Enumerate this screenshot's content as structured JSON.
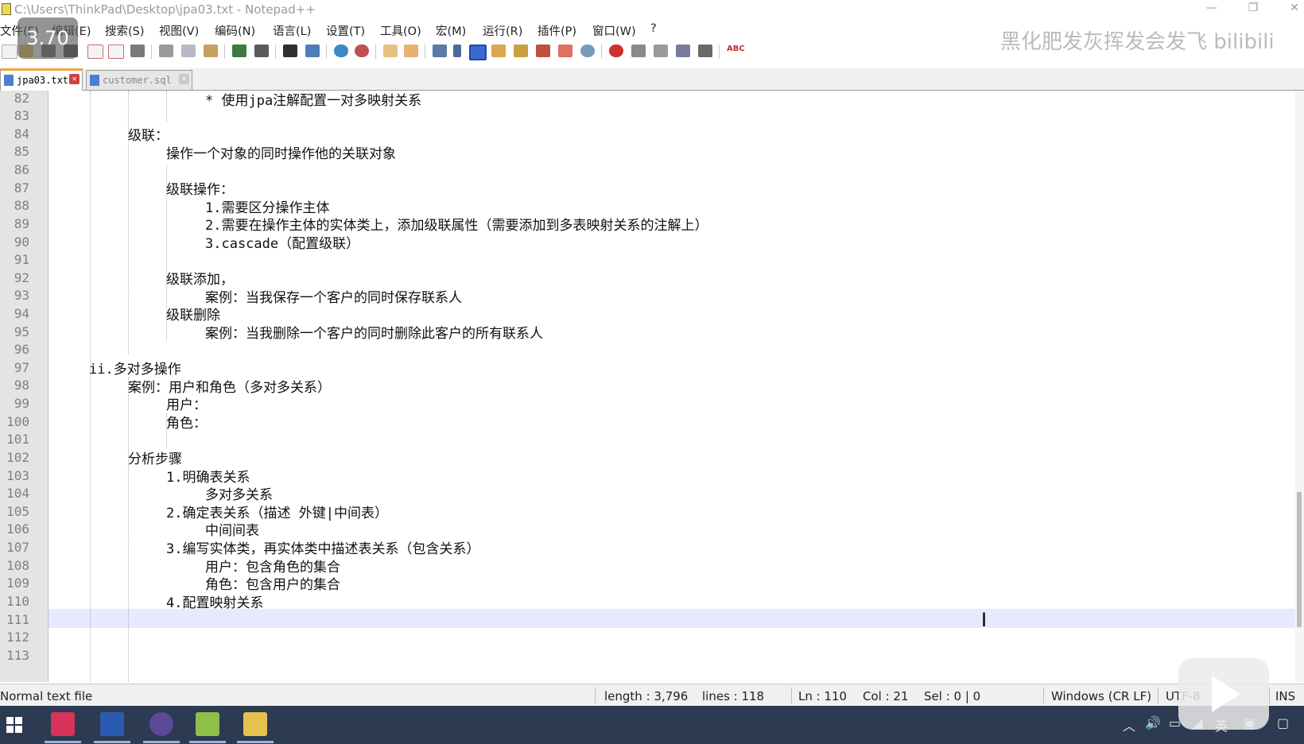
{
  "window": {
    "title": "C:\\Users\\ThinkPad\\Desktop\\jpa03.txt - Notepad++",
    "minimize_glyph": "—",
    "restore_glyph": "❐",
    "close_glyph": "✕"
  },
  "menu": [
    {
      "id": "file",
      "label": "文件(F)"
    },
    {
      "id": "edit",
      "label": "编辑(E)"
    },
    {
      "id": "search",
      "label": "搜索(S)"
    },
    {
      "id": "view",
      "label": "视图(V)"
    },
    {
      "id": "encoding",
      "label": "编码(N)"
    },
    {
      "id": "language",
      "label": "语言(L)"
    },
    {
      "id": "settings",
      "label": "设置(T)"
    },
    {
      "id": "tools",
      "label": "工具(O)"
    },
    {
      "id": "macro",
      "label": "宏(M)"
    },
    {
      "id": "run",
      "label": "运行(R)"
    },
    {
      "id": "plugins",
      "label": "插件(P)"
    },
    {
      "id": "window",
      "label": "窗口(W)"
    },
    {
      "id": "help",
      "label": "?"
    }
  ],
  "toolbar": {
    "icons": [
      "new-file-icon",
      "open-file-icon",
      "save-icon",
      "save-all-icon",
      "close-icon",
      "close-all-icon",
      "print-icon",
      "cut-icon",
      "copy-icon",
      "paste-icon",
      "undo-icon",
      "redo-icon",
      "find-icon",
      "replace-icon",
      "zoom-in-icon",
      "zoom-out-icon",
      "sync-vertical-icon",
      "sync-horizontal-icon",
      "word-wrap-icon",
      "show-all-chars-icon",
      "indent-guide-icon",
      "language-icon",
      "function-list-icon",
      "doc-map-icon",
      "folder-workspace-icon",
      "monitor-icon",
      "record-macro-icon",
      "stop-record-icon",
      "play-macro-icon",
      "run-macro-multiple-icon",
      "save-macro-icon",
      "spell-check-icon"
    ],
    "spellcheck_label": "ABC"
  },
  "tabs": [
    {
      "label": "jpa03.txt",
      "active": true
    },
    {
      "label": "customer.sql",
      "active": false
    }
  ],
  "editor": {
    "current_line": 110,
    "lines": [
      {
        "n": "82",
        "text": "* 使用jpa注解配置一对多映射关系"
      },
      {
        "n": "83",
        "text": ""
      },
      {
        "n": "84",
        "text": "级联："
      },
      {
        "n": "85",
        "text": "操作一个对象的同时操作他的关联对象"
      },
      {
        "n": "86",
        "text": ""
      },
      {
        "n": "87",
        "text": "级联操作："
      },
      {
        "n": "88",
        "text": "1.需要区分操作主体"
      },
      {
        "n": "89",
        "text": "2.需要在操作主体的实体类上，添加级联属性（需要添加到多表映射关系的注解上）"
      },
      {
        "n": "90",
        "text": "3.cascade（配置级联）"
      },
      {
        "n": "91",
        "text": ""
      },
      {
        "n": "92",
        "text": "级联添加，"
      },
      {
        "n": "93",
        "text": "案例：当我保存一个客户的同时保存联系人"
      },
      {
        "n": "94",
        "text": "级联删除"
      },
      {
        "n": "95",
        "text": "案例：当我删除一个客户的同时删除此客户的所有联系人"
      },
      {
        "n": "96",
        "text": ""
      },
      {
        "n": "97",
        "text": "ii.多对多操作"
      },
      {
        "n": "98",
        "text": "案例：用户和角色（多对多关系）"
      },
      {
        "n": "99",
        "text": "用户："
      },
      {
        "n": "100",
        "text": "角色："
      },
      {
        "n": "101",
        "text": ""
      },
      {
        "n": "102",
        "text": "分析步骤"
      },
      {
        "n": "103",
        "text": "1.明确表关系"
      },
      {
        "n": "104",
        "text": "多对多关系"
      },
      {
        "n": "105",
        "text": "2.确定表关系（描述 外键|中间表）"
      },
      {
        "n": "106",
        "text": "中间间表"
      },
      {
        "n": "107",
        "text": "3.编写实体类，再实体类中描述表关系（包含关系）"
      },
      {
        "n": "108",
        "text": "用户：包含角色的集合"
      },
      {
        "n": "109",
        "text": "角色：包含用户的集合"
      },
      {
        "n": "110",
        "text": "4.配置映射关系"
      },
      {
        "n": "111",
        "text": ""
      },
      {
        "n": "112",
        "text": ""
      },
      {
        "n": "113",
        "text": ""
      }
    ]
  },
  "status": {
    "file_type": "Normal text file",
    "length": "length : 3,796",
    "lines": "lines : 118",
    "ln": "Ln : 110",
    "col": "Col : 21",
    "sel": "Sel : 0 | 0",
    "eol": "Windows (CR LF)",
    "encoding": "UTF-8",
    "mode": "INS"
  },
  "overlay": {
    "speed": "3.70",
    "watermark": "黑化肥发灰挥发会发飞 bilibili"
  },
  "taskbar": {
    "apps": [
      "intellij-icon",
      "word-icon",
      "eclipse-icon",
      "notepadpp-icon",
      "file-explorer-icon"
    ],
    "ime": "英"
  },
  "colors": {
    "active_tab_accent": "#f5a23a",
    "current_line_bg": "#e8e8ff",
    "taskbar_bg": "#2c3a52"
  }
}
